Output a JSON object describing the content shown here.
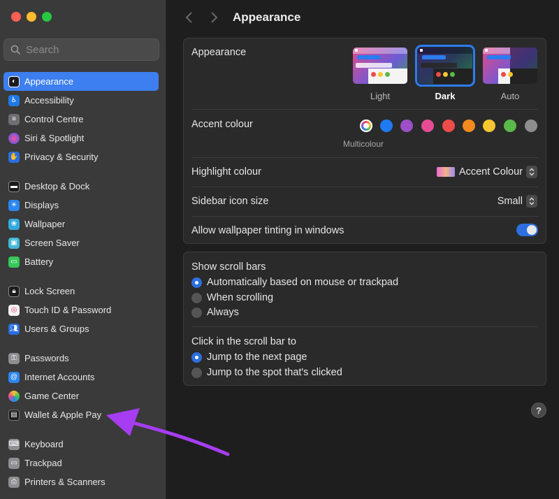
{
  "window": {
    "title": "Appearance",
    "search_placeholder": "Search"
  },
  "sidebar": {
    "items": [
      {
        "label": "Appearance",
        "icon": "appearance-icon",
        "color": "#1c1c1e",
        "active": true
      },
      {
        "label": "Accessibility",
        "icon": "accessibility-icon",
        "color": "#1f7ae8"
      },
      {
        "label": "Control Centre",
        "icon": "control-centre-icon",
        "color": "#6e6e73"
      },
      {
        "label": "Siri & Spotlight",
        "icon": "siri-icon",
        "color": "#b23cd6"
      },
      {
        "label": "Privacy & Security",
        "icon": "hand-icon",
        "color": "#2a6de0"
      },
      {
        "label": "Desktop & Dock",
        "icon": "dock-icon",
        "color": "#1c1c1e"
      },
      {
        "label": "Displays",
        "icon": "sun-icon",
        "color": "#2a86f0"
      },
      {
        "label": "Wallpaper",
        "icon": "wallpaper-icon",
        "color": "#34aadc"
      },
      {
        "label": "Screen Saver",
        "icon": "screen-saver-icon",
        "color": "#41b7d8"
      },
      {
        "label": "Battery",
        "icon": "battery-icon",
        "color": "#34c759"
      },
      {
        "label": "Lock Screen",
        "icon": "lock-icon",
        "color": "#1c1c1e"
      },
      {
        "label": "Touch ID & Password",
        "icon": "fingerprint-icon",
        "color": "#f2f2f2"
      },
      {
        "label": "Users & Groups",
        "icon": "users-icon",
        "color": "#2a6de0"
      },
      {
        "label": "Passwords",
        "icon": "key-icon",
        "color": "#8e8e93"
      },
      {
        "label": "Internet Accounts",
        "icon": "at-icon",
        "color": "#2a86f0"
      },
      {
        "label": "Game Center",
        "icon": "game-center-icon",
        "color": "#f2f2f2"
      },
      {
        "label": "Wallet & Apple Pay",
        "icon": "wallet-icon",
        "color": "#1c1c1e"
      },
      {
        "label": "Keyboard",
        "icon": "keyboard-icon",
        "color": "#8e8e93"
      },
      {
        "label": "Trackpad",
        "icon": "trackpad-icon",
        "color": "#8e8e93"
      },
      {
        "label": "Printers & Scanners",
        "icon": "printer-icon",
        "color": "#8e8e93"
      }
    ]
  },
  "appearance": {
    "label": "Appearance",
    "options": [
      {
        "label": "Light",
        "selected": false
      },
      {
        "label": "Dark",
        "selected": true
      },
      {
        "label": "Auto",
        "selected": false
      }
    ]
  },
  "accent": {
    "label": "Accent colour",
    "selected_label": "Multicolour",
    "colors": [
      "multicolour",
      "#1f7af2",
      "#9c4fc6",
      "#e64c93",
      "#ee4b4b",
      "#f38a1f",
      "#f7c531",
      "#5bb84a",
      "#8e8e8e"
    ]
  },
  "highlight": {
    "label": "Highlight colour",
    "value": "Accent Colour"
  },
  "sidebar_icon_size": {
    "label": "Sidebar icon size",
    "value": "Small"
  },
  "tinting": {
    "label": "Allow wallpaper tinting in windows",
    "on": true
  },
  "scroll_bars": {
    "label": "Show scroll bars",
    "options": [
      {
        "label": "Automatically based on mouse or trackpad",
        "selected": true
      },
      {
        "label": "When scrolling",
        "selected": false
      },
      {
        "label": "Always",
        "selected": false
      }
    ]
  },
  "click_scroll": {
    "label": "Click in the scroll bar to",
    "options": [
      {
        "label": "Jump to the next page",
        "selected": true
      },
      {
        "label": "Jump to the spot that's clicked",
        "selected": false
      }
    ]
  },
  "help_label": "?",
  "annotation_color": "#a63df2"
}
